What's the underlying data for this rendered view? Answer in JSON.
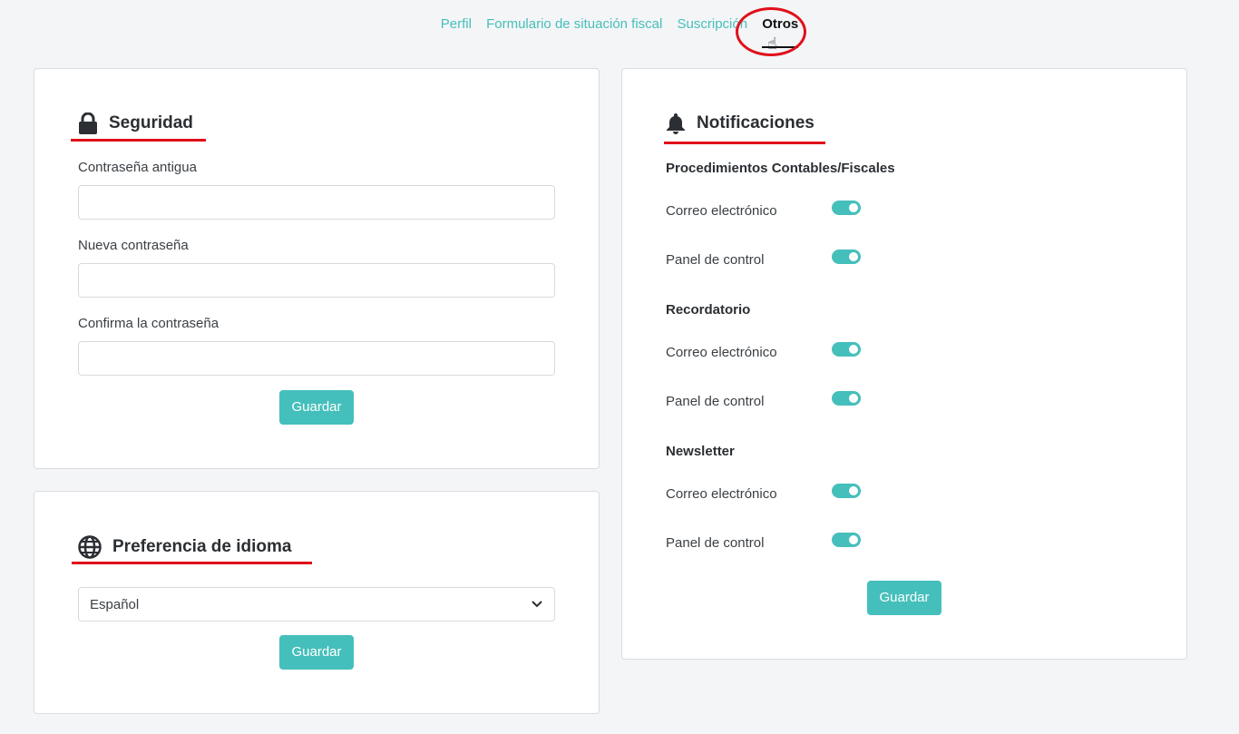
{
  "tabs": [
    {
      "label": "Perfil"
    },
    {
      "label": "Formulario de situación fiscal"
    },
    {
      "label": "Suscripción"
    },
    {
      "label": "Otros"
    }
  ],
  "security": {
    "title": "Seguridad",
    "old_password_label": "Contraseña antigua",
    "new_password_label": "Nueva contraseña",
    "confirm_password_label": "Confirma la contraseña",
    "save_label": "Guardar"
  },
  "language": {
    "title": "Preferencia de idioma",
    "selected": "Español",
    "save_label": "Guardar"
  },
  "notifications": {
    "title": "Notificaciones",
    "sections": [
      {
        "heading": "Procedimientos Contables/Fiscales",
        "email_label": "Correo electrónico",
        "panel_label": "Panel de control"
      },
      {
        "heading": "Recordatorio",
        "email_label": "Correo electrónico",
        "panel_label": "Panel de control"
      },
      {
        "heading": "Newsletter",
        "email_label": "Correo electrónico",
        "panel_label": "Panel de control"
      }
    ],
    "save_label": "Guardar"
  },
  "colors": {
    "accent": "#45bfbb",
    "highlight": "#e0101a"
  }
}
